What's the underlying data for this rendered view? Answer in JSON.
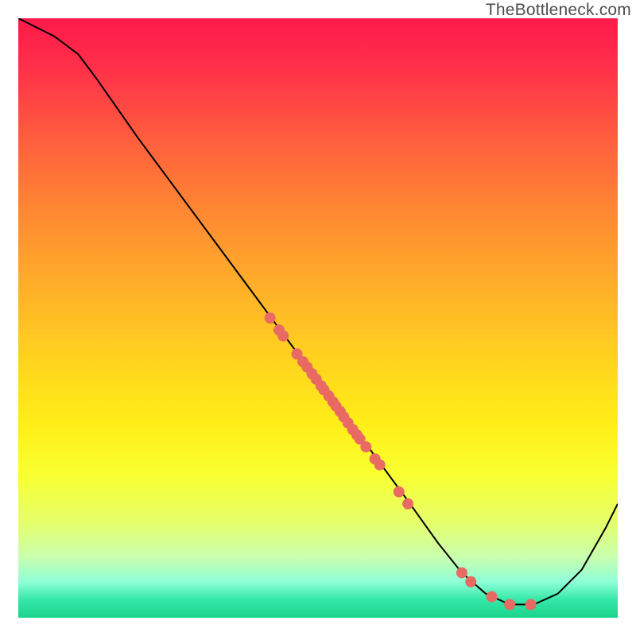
{
  "watermark": "TheBottleneck.com",
  "chart_data": {
    "type": "line",
    "title": "",
    "xlabel": "",
    "ylabel": "",
    "xlim": [
      0,
      100
    ],
    "ylim": [
      0,
      100
    ],
    "curve": [
      {
        "x": 0,
        "y": 100
      },
      {
        "x": 6,
        "y": 97
      },
      {
        "x": 10,
        "y": 94
      },
      {
        "x": 13,
        "y": 90
      },
      {
        "x": 20,
        "y": 80
      },
      {
        "x": 30,
        "y": 66.5
      },
      {
        "x": 40,
        "y": 53
      },
      {
        "x": 50,
        "y": 39.5
      },
      {
        "x": 58,
        "y": 29
      },
      {
        "x": 65,
        "y": 19.5
      },
      {
        "x": 70,
        "y": 12.5
      },
      {
        "x": 74,
        "y": 7.5
      },
      {
        "x": 78,
        "y": 4
      },
      {
        "x": 82,
        "y": 2.2
      },
      {
        "x": 86,
        "y": 2.2
      },
      {
        "x": 90,
        "y": 4
      },
      {
        "x": 94,
        "y": 8
      },
      {
        "x": 98,
        "y": 15
      },
      {
        "x": 100,
        "y": 19
      }
    ],
    "points": [
      {
        "x": 42,
        "y": 50
      },
      {
        "x": 43.5,
        "y": 48
      },
      {
        "x": 44.2,
        "y": 47
      },
      {
        "x": 46.5,
        "y": 44
      },
      {
        "x": 47.5,
        "y": 42.7
      },
      {
        "x": 48.2,
        "y": 41.8
      },
      {
        "x": 49,
        "y": 40.7
      },
      {
        "x": 49.7,
        "y": 39.8
      },
      {
        "x": 50.5,
        "y": 38.7
      },
      {
        "x": 51,
        "y": 38
      },
      {
        "x": 51.8,
        "y": 37
      },
      {
        "x": 52.5,
        "y": 36
      },
      {
        "x": 53,
        "y": 35.3
      },
      {
        "x": 53.7,
        "y": 34.4
      },
      {
        "x": 54.3,
        "y": 33.5
      },
      {
        "x": 55,
        "y": 32.5
      },
      {
        "x": 55.8,
        "y": 31.4
      },
      {
        "x": 56.5,
        "y": 30.5
      },
      {
        "x": 57,
        "y": 29.8
      },
      {
        "x": 58,
        "y": 28.5
      },
      {
        "x": 59.5,
        "y": 26.5
      },
      {
        "x": 60.3,
        "y": 25.5
      },
      {
        "x": 63.5,
        "y": 21
      },
      {
        "x": 65,
        "y": 19
      },
      {
        "x": 74,
        "y": 7.5
      },
      {
        "x": 75.5,
        "y": 6
      },
      {
        "x": 79,
        "y": 3.5
      },
      {
        "x": 82,
        "y": 2.2
      },
      {
        "x": 85.5,
        "y": 2.2
      }
    ],
    "point_radius": 7,
    "colors": {
      "curve": "#000000",
      "points": "#e86a62"
    }
  }
}
